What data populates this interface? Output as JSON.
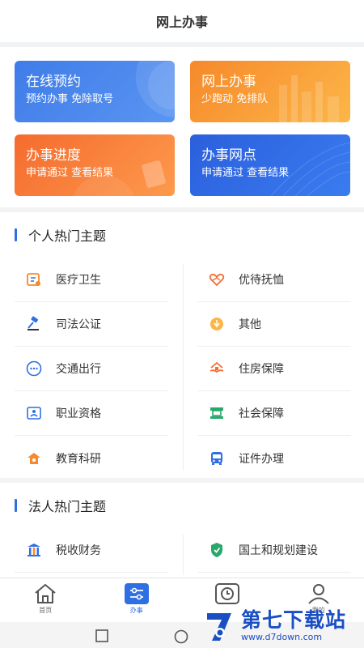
{
  "header": {
    "title": "网上办事"
  },
  "cards": [
    {
      "title": "在线预约",
      "subtitle": "预约办事 免除取号"
    },
    {
      "title": "网上办事",
      "subtitle": "少跑动 免排队"
    },
    {
      "title": "办事进度",
      "subtitle": "申请通过 查看结果"
    },
    {
      "title": "办事网点",
      "subtitle": "申请通过 查看结果"
    }
  ],
  "personal": {
    "title": "个人热门主题",
    "items": [
      {
        "label": "医疗卫生",
        "icon": "medical-icon"
      },
      {
        "label": "优待抚恤",
        "icon": "care-icon"
      },
      {
        "label": "司法公证",
        "icon": "gavel-icon"
      },
      {
        "label": "其他",
        "icon": "other-icon"
      },
      {
        "label": "交通出行",
        "icon": "traffic-icon"
      },
      {
        "label": "住房保障",
        "icon": "housing-icon"
      },
      {
        "label": "职业资格",
        "icon": "certificate-icon"
      },
      {
        "label": "社会保障",
        "icon": "social-security-icon"
      },
      {
        "label": "教育科研",
        "icon": "education-icon"
      },
      {
        "label": "证件办理",
        "icon": "bus-icon"
      }
    ]
  },
  "corporate": {
    "title": "法人热门主题",
    "items": [
      {
        "label": "税收财务",
        "icon": "tax-icon"
      },
      {
        "label": "国土和规划建设",
        "icon": "shield-icon"
      }
    ]
  },
  "tabbar": {
    "items": [
      {
        "label": "首页",
        "icon": "home-icon"
      },
      {
        "label": "办事",
        "icon": "sliders-icon"
      },
      {
        "label": "",
        "icon": "clock-icon"
      },
      {
        "label": "我的",
        "icon": "user-icon"
      }
    ]
  },
  "watermark": {
    "title": "第七下载站",
    "url": "www.d7down.com"
  },
  "colors": {
    "accent": "#2f6fe4",
    "orange": "#f6892b",
    "blue": "#3f7ce8",
    "green": "#2aa86b"
  }
}
